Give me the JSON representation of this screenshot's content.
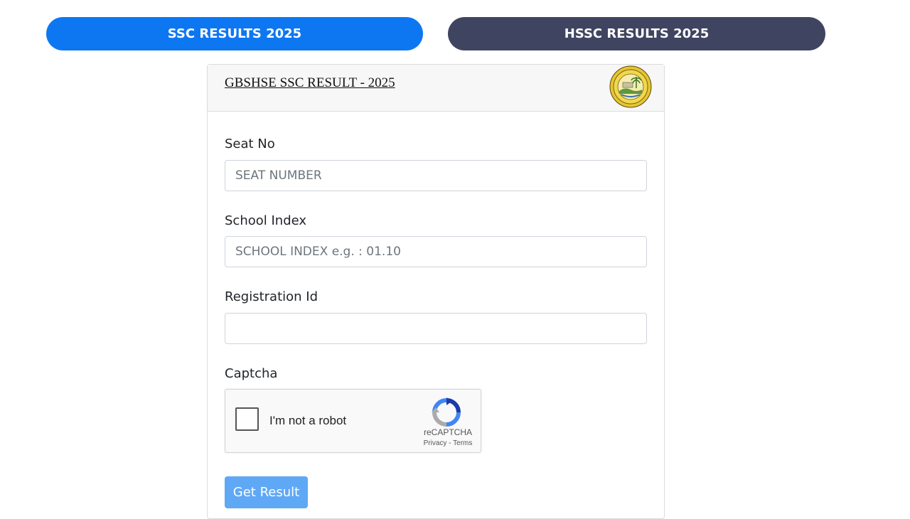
{
  "tabs": {
    "ssc_label": "SSC RESULTS 2025",
    "hssc_label": "HSSC RESULTS 2025"
  },
  "card": {
    "title": "GBSHSE SSC RESULT - 2025",
    "logo_icon": "board-seal-icon"
  },
  "form": {
    "seat_no": {
      "label": "Seat No",
      "placeholder": "SEAT NUMBER",
      "value": ""
    },
    "school_index": {
      "label": "School Index",
      "placeholder": "SCHOOL INDEX e.g. : 01.10",
      "value": ""
    },
    "registration_id": {
      "label": "Registration Id",
      "placeholder": "",
      "value": ""
    },
    "captcha": {
      "label": "Captcha",
      "checkbox_label": "I'm not a robot",
      "brand": "reCAPTCHA",
      "privacy": "Privacy",
      "separator": "-",
      "terms": "Terms"
    },
    "submit_label": "Get Result"
  },
  "colors": {
    "ssc_tab": "#0d77f2",
    "hssc_tab": "#3f4461",
    "submit_button": "#5fa8f6"
  }
}
